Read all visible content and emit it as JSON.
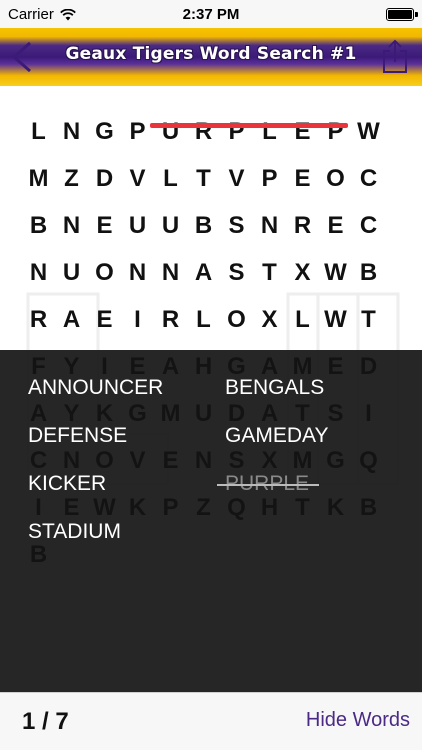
{
  "status_bar": {
    "carrier": "Carrier",
    "time": "2:37 PM"
  },
  "nav": {
    "title": "Geaux Tigers Word Search #1",
    "back_icon": "chevron-left-icon",
    "share_icon": "share-icon"
  },
  "grid": {
    "rows": [
      [
        "L",
        "N",
        "G",
        "P",
        "U",
        "R",
        "P",
        "L",
        "E",
        "P"
      ],
      [
        "W",
        "M",
        "Z",
        "D",
        "V",
        "L",
        "T",
        "V",
        "P",
        "E"
      ],
      [
        "O",
        "C",
        "B",
        "N",
        "E",
        "U",
        "U",
        "B",
        "S",
        "N"
      ],
      [
        "R",
        "E",
        "C",
        "N",
        "U",
        "O",
        "N",
        "N",
        "A",
        "S"
      ],
      [
        "T",
        "X",
        "W",
        "B",
        "R",
        "A",
        "E",
        "I",
        "R",
        "L"
      ],
      [
        "O",
        "X",
        "L",
        "W",
        "T",
        "F",
        "Y",
        "I",
        "E",
        "A"
      ],
      [
        "H",
        "G",
        "A",
        "M",
        "E",
        "D",
        "A",
        "Y",
        "K",
        "G"
      ],
      [
        "M",
        "U",
        "D",
        "A",
        "T",
        "S",
        "I",
        "C",
        "N",
        "O"
      ],
      [
        "V",
        "E",
        "N",
        "S",
        "X",
        "M",
        "G",
        "Q",
        "I",
        "E"
      ],
      [
        "W",
        "K",
        "P",
        "Z",
        "Q",
        "H",
        "T",
        "K",
        "B",
        "B"
      ]
    ]
  },
  "words": [
    {
      "label": "ANNOUNCER",
      "found": false
    },
    {
      "label": "BENGALS",
      "found": false
    },
    {
      "label": "DEFENSE",
      "found": false
    },
    {
      "label": "GAMEDAY",
      "found": false
    },
    {
      "label": "KICKER",
      "found": false
    },
    {
      "label": "PURPLE",
      "found": true
    },
    {
      "label": "STADIUM",
      "found": false
    }
  ],
  "bottom": {
    "counter": "1 / 7",
    "hide_label": "Hide Words"
  },
  "colors": {
    "accent": "#4a2a85",
    "gold": "#f2b700",
    "found_line": "#e8343a"
  }
}
